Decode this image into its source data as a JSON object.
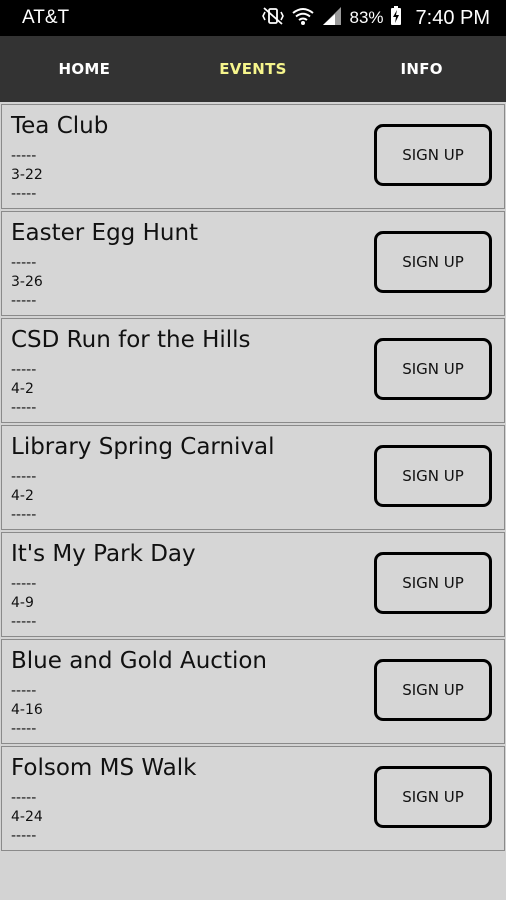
{
  "status_bar": {
    "carrier": "AT&T",
    "battery": "83%",
    "time": "7:40 PM",
    "icons": [
      "vibrate-mute-icon",
      "wifi-icon",
      "signal-icon",
      "battery-charging-icon"
    ]
  },
  "nav": {
    "tabs": [
      {
        "label": "HOME",
        "active": false
      },
      {
        "label": "EVENTS",
        "active": true
      },
      {
        "label": "INFO",
        "active": false
      }
    ],
    "active_color": "#f6f58c"
  },
  "events": [
    {
      "title": "Tea Club",
      "sep1": "-----",
      "date": "3-22",
      "sep2": "-----",
      "button": "SIGN UP"
    },
    {
      "title": "Easter Egg Hunt",
      "sep1": "-----",
      "date": "3-26",
      "sep2": "-----",
      "button": "SIGN UP"
    },
    {
      "title": "CSD Run for the Hills",
      "sep1": "-----",
      "date": "4-2",
      "sep2": "-----",
      "button": "SIGN UP"
    },
    {
      "title": "Library Spring Carnival",
      "sep1": "-----",
      "date": "4-2",
      "sep2": "-----",
      "button": "SIGN UP"
    },
    {
      "title": "It's My Park Day",
      "sep1": "-----",
      "date": "4-9",
      "sep2": "-----",
      "button": "SIGN UP"
    },
    {
      "title": "Blue and Gold Auction",
      "sep1": "-----",
      "date": "4-16",
      "sep2": "-----",
      "button": "SIGN UP"
    },
    {
      "title": "Folsom MS Walk",
      "sep1": "-----",
      "date": "4-24",
      "sep2": "-----",
      "button": "SIGN UP"
    }
  ]
}
